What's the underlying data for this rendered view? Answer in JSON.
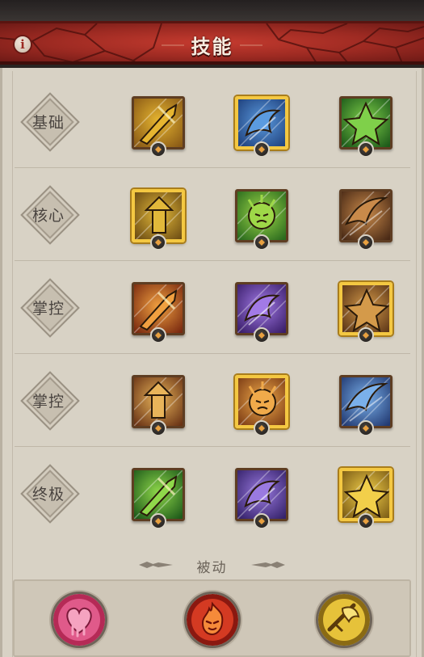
{
  "header": {
    "title": "技能",
    "info_icon": "info-icon",
    "info_glyph": "i"
  },
  "rows": [
    {
      "category": "基础",
      "skills": [
        {
          "icon": "axe-strike-icon",
          "selected": false,
          "colors": [
            "#e6b530",
            "#8a5a16"
          ],
          "badge": "rune-icon"
        },
        {
          "icon": "ice-hammer-icon",
          "selected": true,
          "colors": [
            "#5b9be0",
            "#1e3f7a"
          ],
          "badge": "rune-icon"
        },
        {
          "icon": "green-hammer-icon",
          "selected": false,
          "colors": [
            "#7fd04a",
            "#1d5a1a"
          ],
          "badge": "rune-icon"
        }
      ]
    },
    {
      "category": "核心",
      "skills": [
        {
          "icon": "whirlwind-icon",
          "selected": true,
          "colors": [
            "#e2b83a",
            "#6a4a12"
          ],
          "badge": "rune-icon"
        },
        {
          "icon": "green-slash-icon",
          "selected": false,
          "colors": [
            "#9ed848",
            "#2a6a1e"
          ],
          "badge": "rune-icon"
        },
        {
          "icon": "fire-totem-icon",
          "selected": false,
          "colors": [
            "#c98a4a",
            "#4a2a16"
          ],
          "badge": "rune-icon"
        }
      ]
    },
    {
      "category": "掌控",
      "skills": [
        {
          "icon": "flame-leap-icon",
          "selected": false,
          "colors": [
            "#f0a040",
            "#7a2a10"
          ],
          "badge": "rune-icon"
        },
        {
          "icon": "shadow-burst-icon",
          "selected": false,
          "colors": [
            "#a27ae6",
            "#3a1e6a"
          ],
          "badge": "rune-icon"
        },
        {
          "icon": "earth-pillar-icon",
          "selected": true,
          "colors": [
            "#d49a4a",
            "#5a3416"
          ],
          "badge": "rune-icon"
        }
      ]
    },
    {
      "category": "掌控",
      "skills": [
        {
          "icon": "rage-fist-icon",
          "selected": false,
          "colors": [
            "#e8b45a",
            "#6a3416"
          ],
          "badge": "rune-icon"
        },
        {
          "icon": "war-cry-icon",
          "selected": true,
          "colors": [
            "#f0aa4a",
            "#7a3a14"
          ],
          "badge": "rune-icon"
        },
        {
          "icon": "frost-shout-icon",
          "selected": false,
          "colors": [
            "#7ab0ea",
            "#223a72"
          ],
          "badge": "rune-icon"
        }
      ]
    },
    {
      "category": "终极",
      "skills": [
        {
          "icon": "green-whirl-icon",
          "selected": false,
          "colors": [
            "#8fd84a",
            "#1e5a1a"
          ],
          "badge": "rune-icon"
        },
        {
          "icon": "demon-form-icon",
          "selected": false,
          "colors": [
            "#9a7ae0",
            "#35226a"
          ],
          "badge": "rune-icon"
        },
        {
          "icon": "berserker-icon",
          "selected": true,
          "colors": [
            "#f2cf4a",
            "#7a5a14"
          ],
          "badge": "rune-icon"
        }
      ]
    }
  ],
  "passive": {
    "label": "被动",
    "skills": [
      {
        "icon": "heart-icon",
        "colors": [
          "#e05a8a",
          "#7a1a3a"
        ]
      },
      {
        "icon": "flame-face-icon",
        "colors": [
          "#e84a2a",
          "#7a1410"
        ]
      },
      {
        "icon": "golden-axe-icon",
        "colors": [
          "#eecb3a",
          "#6a4a10"
        ]
      }
    ]
  }
}
